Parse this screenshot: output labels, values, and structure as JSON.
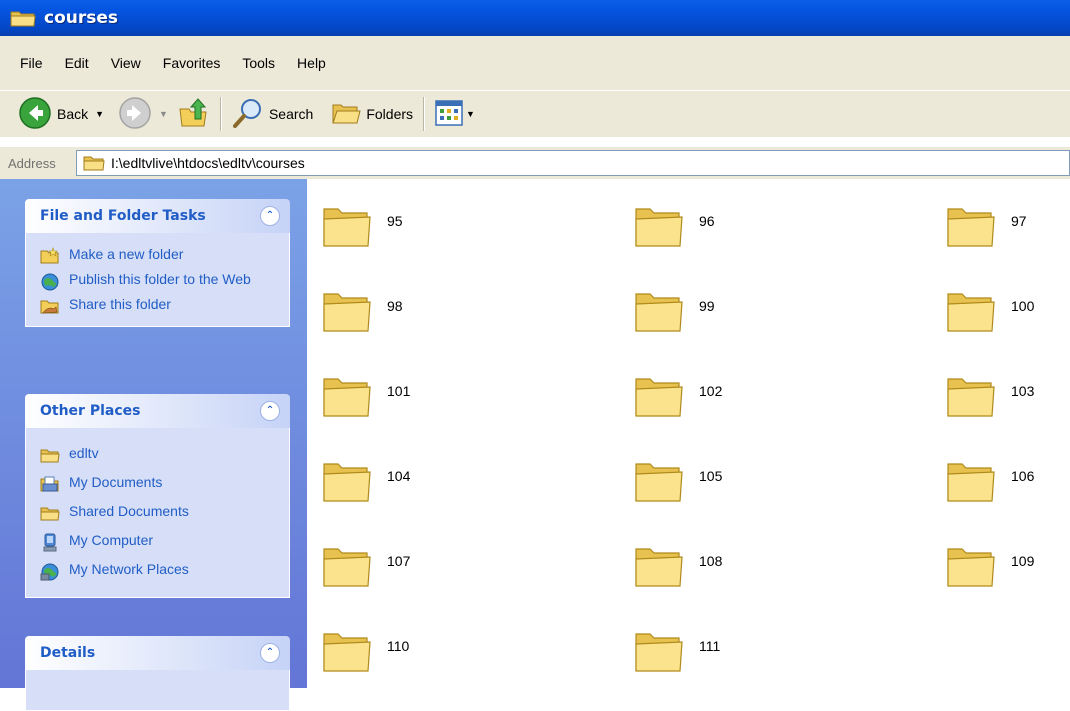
{
  "window": {
    "title": "courses"
  },
  "menu": [
    "File",
    "Edit",
    "View",
    "Favorites",
    "Tools",
    "Help"
  ],
  "toolbar": {
    "back_label": "Back",
    "search_label": "Search",
    "folders_label": "Folders"
  },
  "address": {
    "label": "Address",
    "value": "I:\\edltvlive\\htdocs\\edltv\\courses"
  },
  "tasks_panel": {
    "title": "File and Folder Tasks",
    "items": [
      "Make a new folder",
      "Publish this folder to the Web",
      "Share this folder"
    ]
  },
  "places_panel": {
    "title": "Other Places",
    "items": [
      "edltv",
      "My Documents",
      "Shared Documents",
      "My Computer",
      "My Network Places"
    ]
  },
  "details_panel": {
    "title": "Details"
  },
  "folders": [
    "95",
    "96",
    "97",
    "98",
    "99",
    "100",
    "101",
    "102",
    "103",
    "104",
    "105",
    "106",
    "107",
    "108",
    "109",
    "110",
    "111"
  ],
  "colors": {
    "titlebar": "#0554e0",
    "task_link": "#215dc6",
    "pane": "#7ba2e7",
    "folder": "#f7d774"
  }
}
